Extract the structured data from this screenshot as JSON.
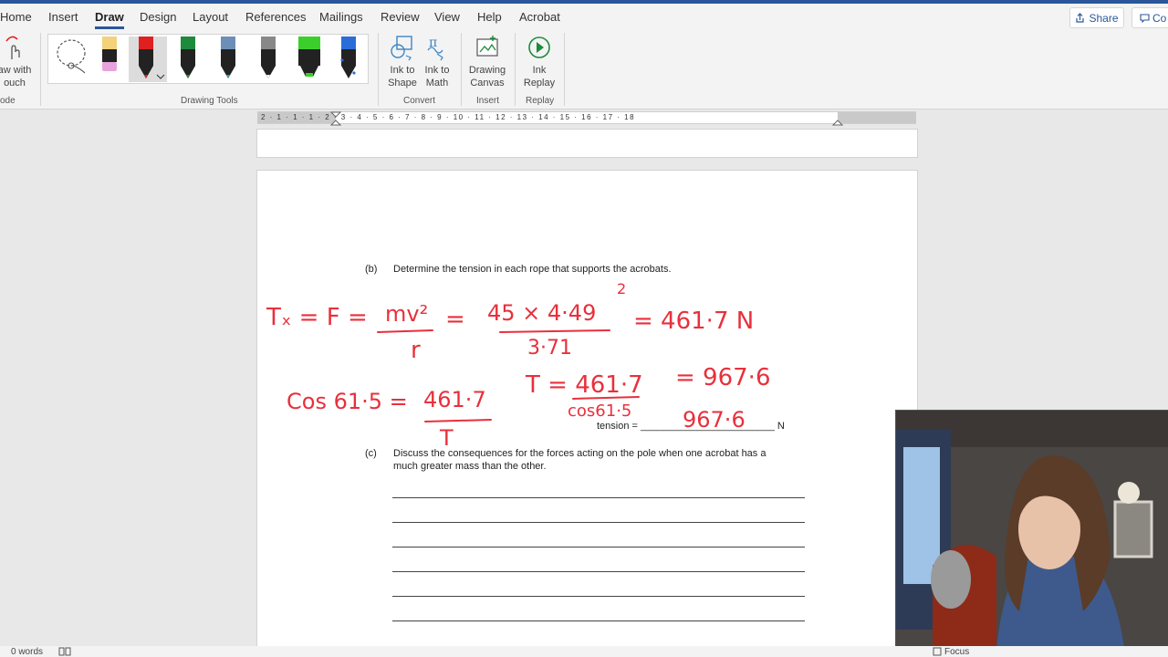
{
  "menu": {
    "tabs": [
      {
        "label": "Home",
        "active": false
      },
      {
        "label": "Insert",
        "active": false
      },
      {
        "label": "Draw",
        "active": true
      },
      {
        "label": "Design",
        "active": false
      },
      {
        "label": "Layout",
        "active": false
      },
      {
        "label": "References",
        "active": false
      },
      {
        "label": "Mailings",
        "active": false
      },
      {
        "label": "Review",
        "active": false
      },
      {
        "label": "View",
        "active": false
      },
      {
        "label": "Help",
        "active": false
      },
      {
        "label": "Acrobat",
        "active": false
      }
    ],
    "share_label": "Share",
    "comments_label": "Co"
  },
  "ribbon": {
    "draw_with_touch_line1": "aw with",
    "draw_with_touch_line2": "ouch",
    "mode_group_label": "ode",
    "drawing_tools_label": "Drawing Tools",
    "ink_to_shape_line1": "Ink to",
    "ink_to_shape_line2": "Shape",
    "ink_to_math_line1": "Ink to",
    "ink_to_math_line2": "Math",
    "convert_label": "Convert",
    "drawing_canvas_line1": "Drawing",
    "drawing_canvas_line2": "Canvas",
    "insert_label": "Insert",
    "ink_replay_line1": "Ink",
    "ink_replay_line2": "Replay",
    "replay_label": "Replay",
    "pens": [
      {
        "name": "lasso",
        "color": "#555555"
      },
      {
        "name": "pencil-yellow",
        "color": "#f3d27a"
      },
      {
        "name": "pen-red",
        "color": "#e02020"
      },
      {
        "name": "pen-green",
        "color": "#1e8a3c"
      },
      {
        "name": "pen-teal",
        "color": "#3aa0a0"
      },
      {
        "name": "pen-grey",
        "color": "#888888"
      },
      {
        "name": "highlighter-green",
        "color": "#3ccf2c"
      },
      {
        "name": "pen-galaxy",
        "color": "#2b6dd8"
      }
    ]
  },
  "ruler": {
    "numbers": "2 · 1 · 1 · 1 · 2 · 3 · 4 · 5 · 6 · 7 · 8 · 9 · 10 · 11 · 12 · 13 · 14 · 15 · 16 · 17 · 18"
  },
  "document": {
    "q_b_label": "(b)",
    "q_b_text": "Determine the tension in each rope that supports the acrobats.",
    "tension_label": "tension = ________________________ N",
    "q_c_label": "(c)",
    "q_c_line1": "Discuss the consequences for the forces acting on the pole when one acrobat has a",
    "q_c_line2": "much greater mass than the other.",
    "answer_line_count": 6
  },
  "ink": {
    "line1_left": "Tₓ = F =",
    "line1_mv": "mv²",
    "line1_r": "r",
    "line1_num": "45 × 4·49",
    "line1_exp": "2",
    "line1_den": "3·71",
    "line1_result": "= 461·7 N",
    "line2_cos": "Cos 61·5 =",
    "line2_num": "461·7",
    "line2_den": "T",
    "line2_t": "T = 461·7",
    "line2_tden": "cos61·5",
    "line2_res": "= 967·6",
    "line2_ans": "967·6"
  },
  "status": {
    "word_count": "0 words",
    "focus_label": "Focus"
  }
}
